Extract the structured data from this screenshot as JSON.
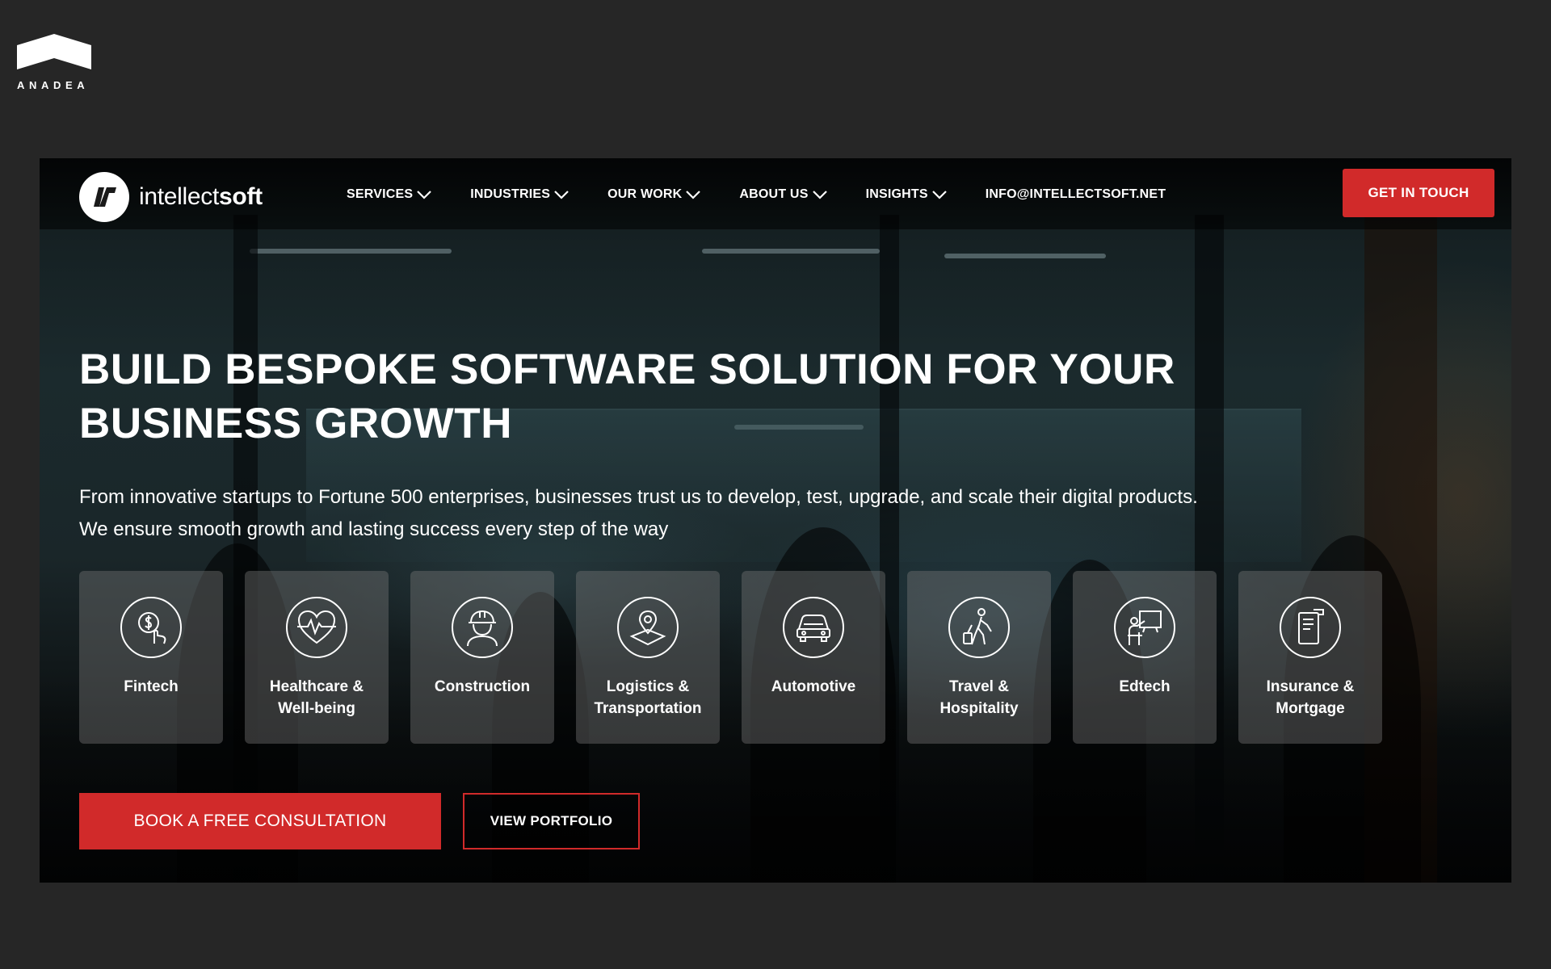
{
  "watermark": {
    "brand_text": "ANADEA",
    "logo_icon": "anadea-roof-logo"
  },
  "header": {
    "logo": {
      "icon": "intellectsoft-logo-mark",
      "text_light": "intellect",
      "text_bold": "soft"
    },
    "nav": [
      {
        "label": "SERVICES",
        "icon": "chevron-down-icon"
      },
      {
        "label": "INDUSTRIES",
        "icon": "chevron-down-icon"
      },
      {
        "label": "OUR WORK",
        "icon": "chevron-down-icon"
      },
      {
        "label": "ABOUT US",
        "icon": "chevron-down-icon"
      },
      {
        "label": "INSIGHTS",
        "icon": "chevron-down-icon"
      }
    ],
    "email": "INFO@INTELLECTSOFT.NET",
    "cta_label": "GET IN TOUCH"
  },
  "hero": {
    "title_line1": "BUILD BESPOKE SOFTWARE SOLUTION FOR YOUR",
    "title_line2": "BUSINESS GROWTH",
    "subtitle_line1": "From innovative startups to Fortune 500 enterprises, businesses trust us to develop, test, upgrade, and scale their digital products.",
    "subtitle_line2": "We ensure smooth growth and lasting success every step of the way"
  },
  "industries": [
    {
      "line1": "Fintech",
      "line2": "",
      "icon": "dollar-hand-icon"
    },
    {
      "line1": "Healthcare &",
      "line2": "Well-being",
      "icon": "heart-pulse-icon"
    },
    {
      "line1": "Construction",
      "line2": "",
      "icon": "worker-helmet-icon"
    },
    {
      "line1": "Logistics &",
      "line2": "Transportation",
      "icon": "location-pin-icon"
    },
    {
      "line1": "Automotive",
      "line2": "",
      "icon": "car-icon"
    },
    {
      "line1": "Travel &",
      "line2": "Hospitality",
      "icon": "traveler-luggage-icon"
    },
    {
      "line1": "Edtech",
      "line2": "",
      "icon": "teacher-board-icon"
    },
    {
      "line1": "Insurance &",
      "line2": "Mortgage",
      "icon": "document-icon"
    }
  ],
  "cta": {
    "primary_label": "BOOK A FREE CONSULTATION",
    "secondary_label": "VIEW PORTFOLIO"
  },
  "colors": {
    "page_background": "#262626",
    "accent_red": "#d12a2a",
    "text": "#ffffff",
    "card_background": "rgba(120,120,120,0.42)"
  }
}
